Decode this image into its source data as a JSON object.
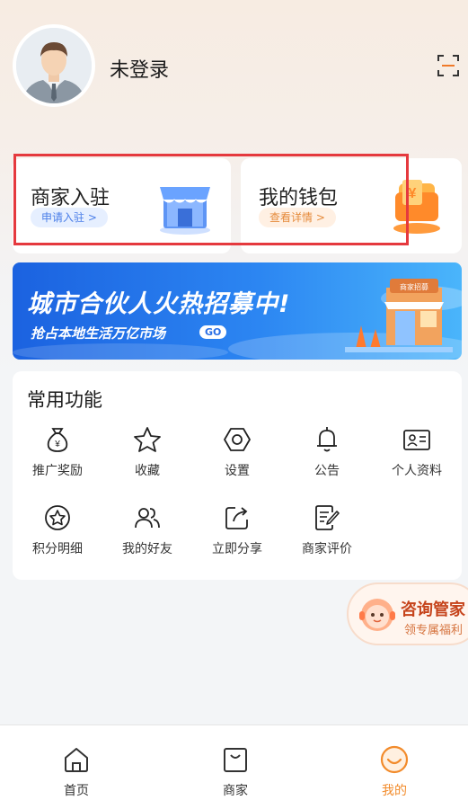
{
  "user": {
    "name": "未登录"
  },
  "cards": {
    "merchant": {
      "title": "商家入驻",
      "sub": "申请入驻 >"
    },
    "wallet": {
      "title": "我的钱包",
      "sub": "查看详情 >"
    }
  },
  "banner": {
    "title": "城市合伙人火热招募中!",
    "subtitle": "抢占本地生活万亿市场",
    "go": "GO",
    "sign": "商家招募"
  },
  "functions": {
    "title": "常用功能",
    "items": [
      {
        "label": "推广奖励",
        "icon": "money-bag-icon"
      },
      {
        "label": "收藏",
        "icon": "star-icon"
      },
      {
        "label": "设置",
        "icon": "settings-hexagon-icon"
      },
      {
        "label": "公告",
        "icon": "bell-icon"
      },
      {
        "label": "个人资料",
        "icon": "id-card-icon"
      },
      {
        "label": "积分明细",
        "icon": "points-star-icon"
      },
      {
        "label": "我的好友",
        "icon": "friends-icon"
      },
      {
        "label": "立即分享",
        "icon": "share-icon"
      },
      {
        "label": "商家评价",
        "icon": "review-icon"
      }
    ]
  },
  "consult": {
    "title": "咨询管家",
    "sub": "领专属福利"
  },
  "tabbar": {
    "items": [
      {
        "label": "首页",
        "icon": "home-icon"
      },
      {
        "label": "商家",
        "icon": "shopping-bag-icon"
      },
      {
        "label": "我的",
        "icon": "profile-smile-icon"
      }
    ],
    "active": "我的"
  },
  "colors": {
    "accent": "#f28b2b",
    "highlight": "#e5393e",
    "banner": "#2c86f2"
  }
}
